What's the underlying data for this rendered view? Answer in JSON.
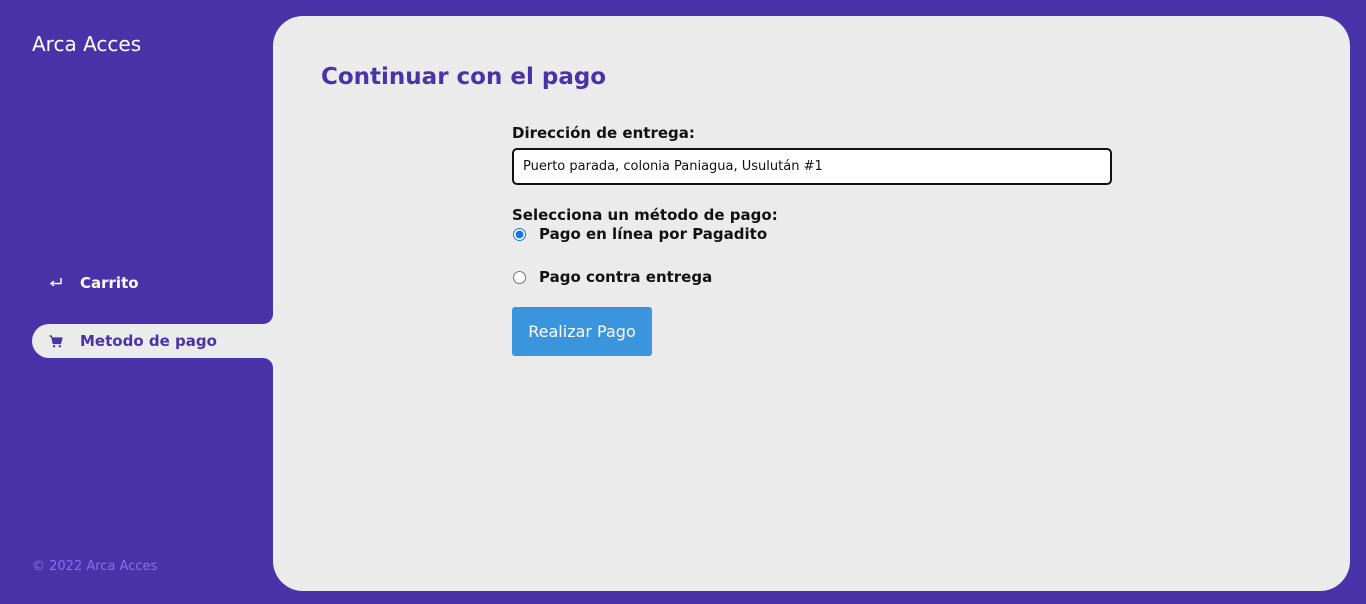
{
  "sidebar": {
    "brand": "Arca Acces",
    "items": [
      {
        "label": "Carrito",
        "icon": "return-arrow-icon",
        "active": false
      },
      {
        "label": "Metodo de pago",
        "icon": "cart-icon",
        "active": true
      }
    ],
    "copyright": "© 2022 Arca Acces"
  },
  "main": {
    "title": "Continuar con el pago",
    "address": {
      "label": "Dirección de entrega:",
      "value": "Puerto parada, colonia Paniagua, Usulután #1"
    },
    "payment": {
      "label": "Selecciona un método de pago:",
      "options": [
        {
          "label": "Pago en línea por Pagadito",
          "checked": true
        },
        {
          "label": "Pago contra entrega",
          "checked": false
        }
      ]
    },
    "submit_label": "Realizar Pago"
  },
  "colors": {
    "brand": "#4a33a8",
    "panel": "#ebebeb",
    "button": "#3a95dd",
    "copyright": "#8a6ef0"
  }
}
